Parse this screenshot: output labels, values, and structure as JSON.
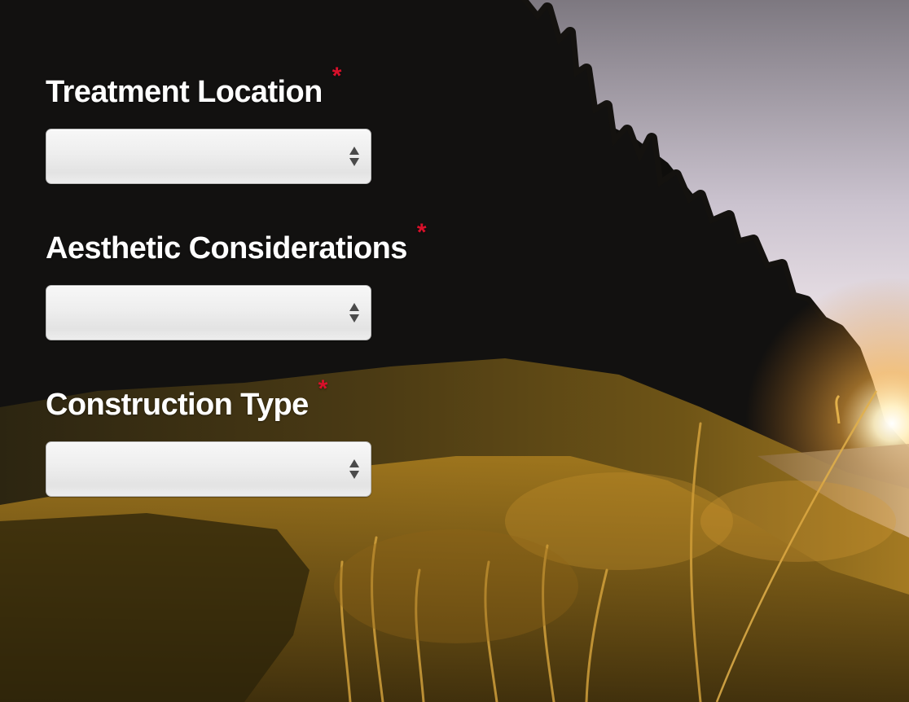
{
  "form": {
    "required_marker": "*",
    "fields": [
      {
        "label": "Treatment Location",
        "value": ""
      },
      {
        "label": "Aesthetic Considerations",
        "value": ""
      },
      {
        "label": "Construction Type",
        "value": ""
      }
    ]
  },
  "colors": {
    "label_text": "#ffffff",
    "required_marker": "#d8102a",
    "select_background": "#eeeeee",
    "select_border": "#b9b9b9",
    "select_arrow": "#4a4a4a"
  },
  "icons": {
    "select_arrows": "up-down-chevron-icon"
  },
  "background": {
    "subject": "sunset-hillside-photo"
  }
}
